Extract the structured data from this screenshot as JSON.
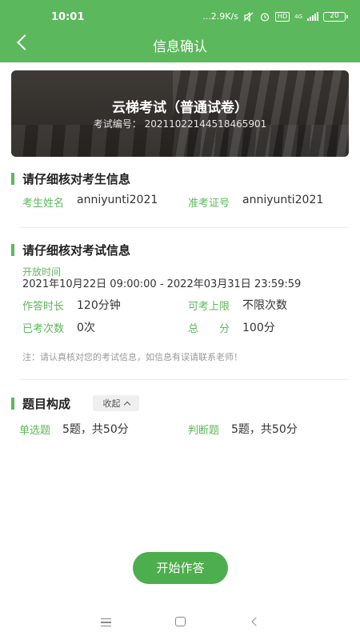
{
  "status_bar": {
    "time": "10:01",
    "network_speed": "...2.9K/s",
    "hd": "HD",
    "network_type": "4G",
    "battery": "20"
  },
  "header": {
    "title": "信息确认",
    "color": "#5cb85c"
  },
  "banner": {
    "title": "云梯考试（普通试卷）",
    "exam_code_label": "考试编号：",
    "exam_code": "20211022144518465901"
  },
  "candidate_section": {
    "title": "请仔细核对考生信息",
    "name_label": "考生姓名",
    "name_value": "anniyunti2021",
    "ticket_label": "准考证号",
    "ticket_value": "anniyunti2021"
  },
  "exam_section": {
    "title": "请仔细核对考试信息",
    "open_time_label": "开放时间",
    "open_time_value": "2021年10月22日 09:00:00 - 2022年03月31日 23:59:59",
    "duration_label": "作答时长",
    "duration_value": "120分钟",
    "limit_label": "可考上限",
    "limit_value": "不限次数",
    "taken_label": "已考次数",
    "taken_value": "0次",
    "total_label": "总　　分",
    "total_value": "100分",
    "note": "注：请认真核对您的考试信息，如信息有误请联系老师！"
  },
  "composition_section": {
    "title": "题目构成",
    "collapse_label": "收起",
    "single_choice_label": "单选题",
    "single_choice_value": "5题，共50分",
    "true_false_label": "判断题",
    "true_false_value": "5题，共50分"
  },
  "start_button": {
    "label": "开始作答"
  },
  "icons": {
    "back": "back-chevron-icon",
    "collapse": "chevron-up-icon",
    "nav_menu": "menu-icon",
    "nav_home": "home-square-icon",
    "nav_back": "back-triangle-icon"
  }
}
